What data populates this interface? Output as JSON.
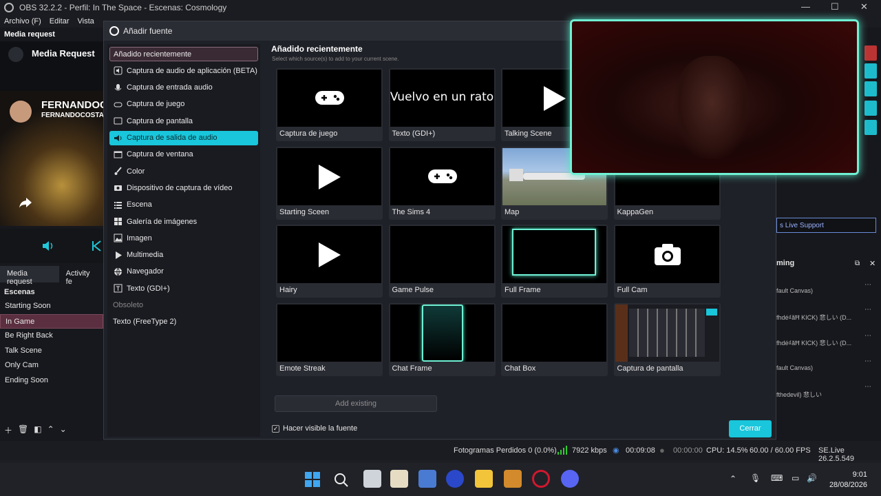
{
  "app": {
    "title": "OBS 32.2.2 - Perfil: In The Space - Escenas: Cosmology",
    "menu": [
      "Archivo (F)",
      "Editar",
      "Vista"
    ]
  },
  "left_panel": {
    "dock_title": "Media request",
    "banner_title": "Media Request",
    "streamer_name": "FERNANDOC",
    "streamer_handle": "FERNANDOCOSTA",
    "tabs": [
      "Media request",
      "Activity fe"
    ],
    "scenes_title": "Escenas",
    "scenes": [
      "Starting Soon",
      "In Game",
      "Be Right Back",
      "Talk Scene",
      "Only Cam",
      "Ending Soon"
    ],
    "selected_scene": "In Game"
  },
  "dialog": {
    "title": "Añadir fuente",
    "types": [
      {
        "label": "Añadido recientemente",
        "icon": "none",
        "state": "recent"
      },
      {
        "label": "Captura de audio de aplicación (BETA)",
        "icon": "app-audio-icon",
        "state": ""
      },
      {
        "label": "Captura de entrada audio",
        "icon": "microphone-icon",
        "state": ""
      },
      {
        "label": "Captura de juego",
        "icon": "gamepad-icon",
        "state": ""
      },
      {
        "label": "Captura de pantalla",
        "icon": "monitor-icon",
        "state": ""
      },
      {
        "label": "Captura de salida de audio",
        "icon": "speaker-icon",
        "state": "active"
      },
      {
        "label": "Captura de ventana",
        "icon": "window-icon",
        "state": ""
      },
      {
        "label": "Color",
        "icon": "brush-icon",
        "state": ""
      },
      {
        "label": "Dispositivo de captura de vídeo",
        "icon": "camera-icon",
        "state": ""
      },
      {
        "label": "Escena",
        "icon": "list-icon",
        "state": ""
      },
      {
        "label": "Galería de imágenes",
        "icon": "gallery-icon",
        "state": ""
      },
      {
        "label": "Imagen",
        "icon": "image-icon",
        "state": ""
      },
      {
        "label": "Multimedia",
        "icon": "play-icon",
        "state": ""
      },
      {
        "label": "Navegador",
        "icon": "globe-icon",
        "state": ""
      },
      {
        "label": "Texto (GDI+)",
        "icon": "text-icon",
        "state": ""
      },
      {
        "label": "Obsoleto",
        "icon": "none",
        "state": "header"
      },
      {
        "label": "Texto (FreeType 2)",
        "icon": "none",
        "state": ""
      }
    ],
    "content_title": "Añadido recientemente",
    "content_subtitle": "Select which source(s) to add to your current scene.",
    "tiles": [
      {
        "label": "Captura de juego",
        "preview": "gamepad"
      },
      {
        "label": "Texto (GDI+)",
        "preview": "text",
        "preview_text": "Vuelvo en un rato"
      },
      {
        "label": "Talking Scene",
        "preview": "play"
      },
      {
        "label": "",
        "preview": "hidden"
      },
      {
        "label": "Starting Sceen",
        "preview": "play"
      },
      {
        "label": "The Sims 4",
        "preview": "gamepad"
      },
      {
        "label": "Map",
        "preview": "map"
      },
      {
        "label": "KappaGen",
        "preview": "black"
      },
      {
        "label": "Hairy",
        "preview": "play"
      },
      {
        "label": "Game Pulse",
        "preview": "black"
      },
      {
        "label": "Full Frame",
        "preview": "frame"
      },
      {
        "label": "Full Cam",
        "preview": "camera"
      },
      {
        "label": "Emote Streak",
        "preview": "black"
      },
      {
        "label": "Chat Frame",
        "preview": "chatframe"
      },
      {
        "label": "Chat Box",
        "preview": "black"
      },
      {
        "label": "Captura de pantalla",
        "preview": "screenshot"
      }
    ],
    "add_existing": "Add existing",
    "visible_label": "Hacer visible la fuente",
    "close_label": "Cerrar"
  },
  "right_panel": {
    "live_support": "s Live Support",
    "stream_title": "ming",
    "rows": [
      "fault Canvas)",
      "fhdé₫ăĦ KICK) 悲しい (D...",
      "fhdé₫ăĦ KICK) 悲しい (D...",
      "fault Canvas)",
      "fthedevil) 悲しい"
    ]
  },
  "status": {
    "dropped": "Fotogramas Perdidos 0 (0.0%)",
    "bitrate": "7922 kbps",
    "stream_time": "00:09:08",
    "rec_time": "00:00:00",
    "cpu": "CPU: 14.5%",
    "fps": "60.00 / 60.00 FPS",
    "version": "SE.Live 26.2.5.549"
  },
  "taskbar": {
    "time": "9:01",
    "date": "28/08/2026"
  },
  "colors": {
    "accent": "#19c6db",
    "webcam_border": "#6ff1d4"
  }
}
